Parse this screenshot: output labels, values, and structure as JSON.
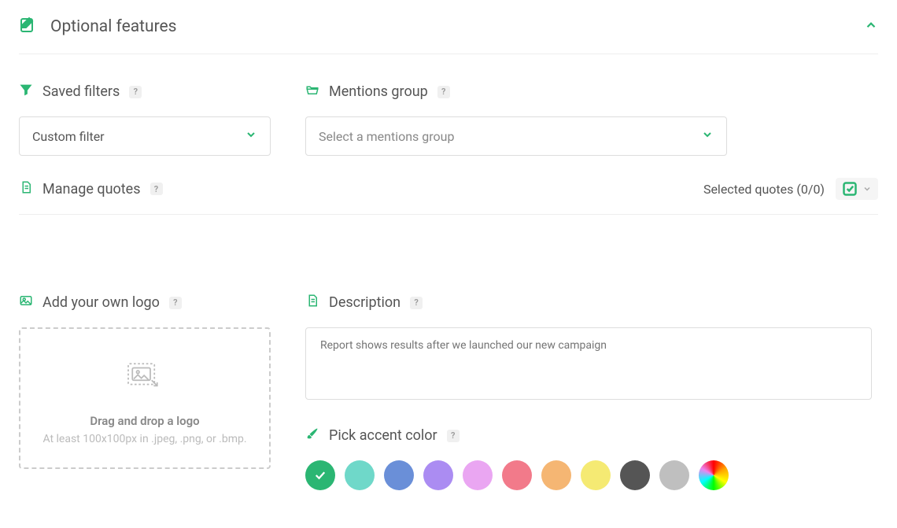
{
  "panel": {
    "title": "Optional features"
  },
  "saved_filters": {
    "label": "Saved filters",
    "value": "Custom filter"
  },
  "mentions_group": {
    "label": "Mentions group",
    "placeholder": "Select a mentions group"
  },
  "manage_quotes": {
    "label": "Manage quotes",
    "selected_text": "Selected quotes (0/0)"
  },
  "logo": {
    "label": "Add your own logo",
    "drop_title": "Drag and drop a logo",
    "drop_sub": "At least 100x100px in .jpeg, .png, or .bmp."
  },
  "description": {
    "label": "Description",
    "placeholder": "Report shows results after we launched our new campaign"
  },
  "accent": {
    "label": "Pick accent color",
    "colors": [
      {
        "hex": "#2bb673",
        "selected": true
      },
      {
        "hex": "#6fd8c9",
        "selected": false
      },
      {
        "hex": "#6a8fd8",
        "selected": false
      },
      {
        "hex": "#ab8cf2",
        "selected": false
      },
      {
        "hex": "#eaa6f2",
        "selected": false
      },
      {
        "hex": "#f27a8a",
        "selected": false
      },
      {
        "hex": "#f5b673",
        "selected": false
      },
      {
        "hex": "#f5ea73",
        "selected": false
      },
      {
        "hex": "#555555",
        "selected": false
      },
      {
        "hex": "#bfbfbf",
        "selected": false
      },
      {
        "hex": "rainbow",
        "selected": false
      }
    ]
  },
  "help": "?"
}
